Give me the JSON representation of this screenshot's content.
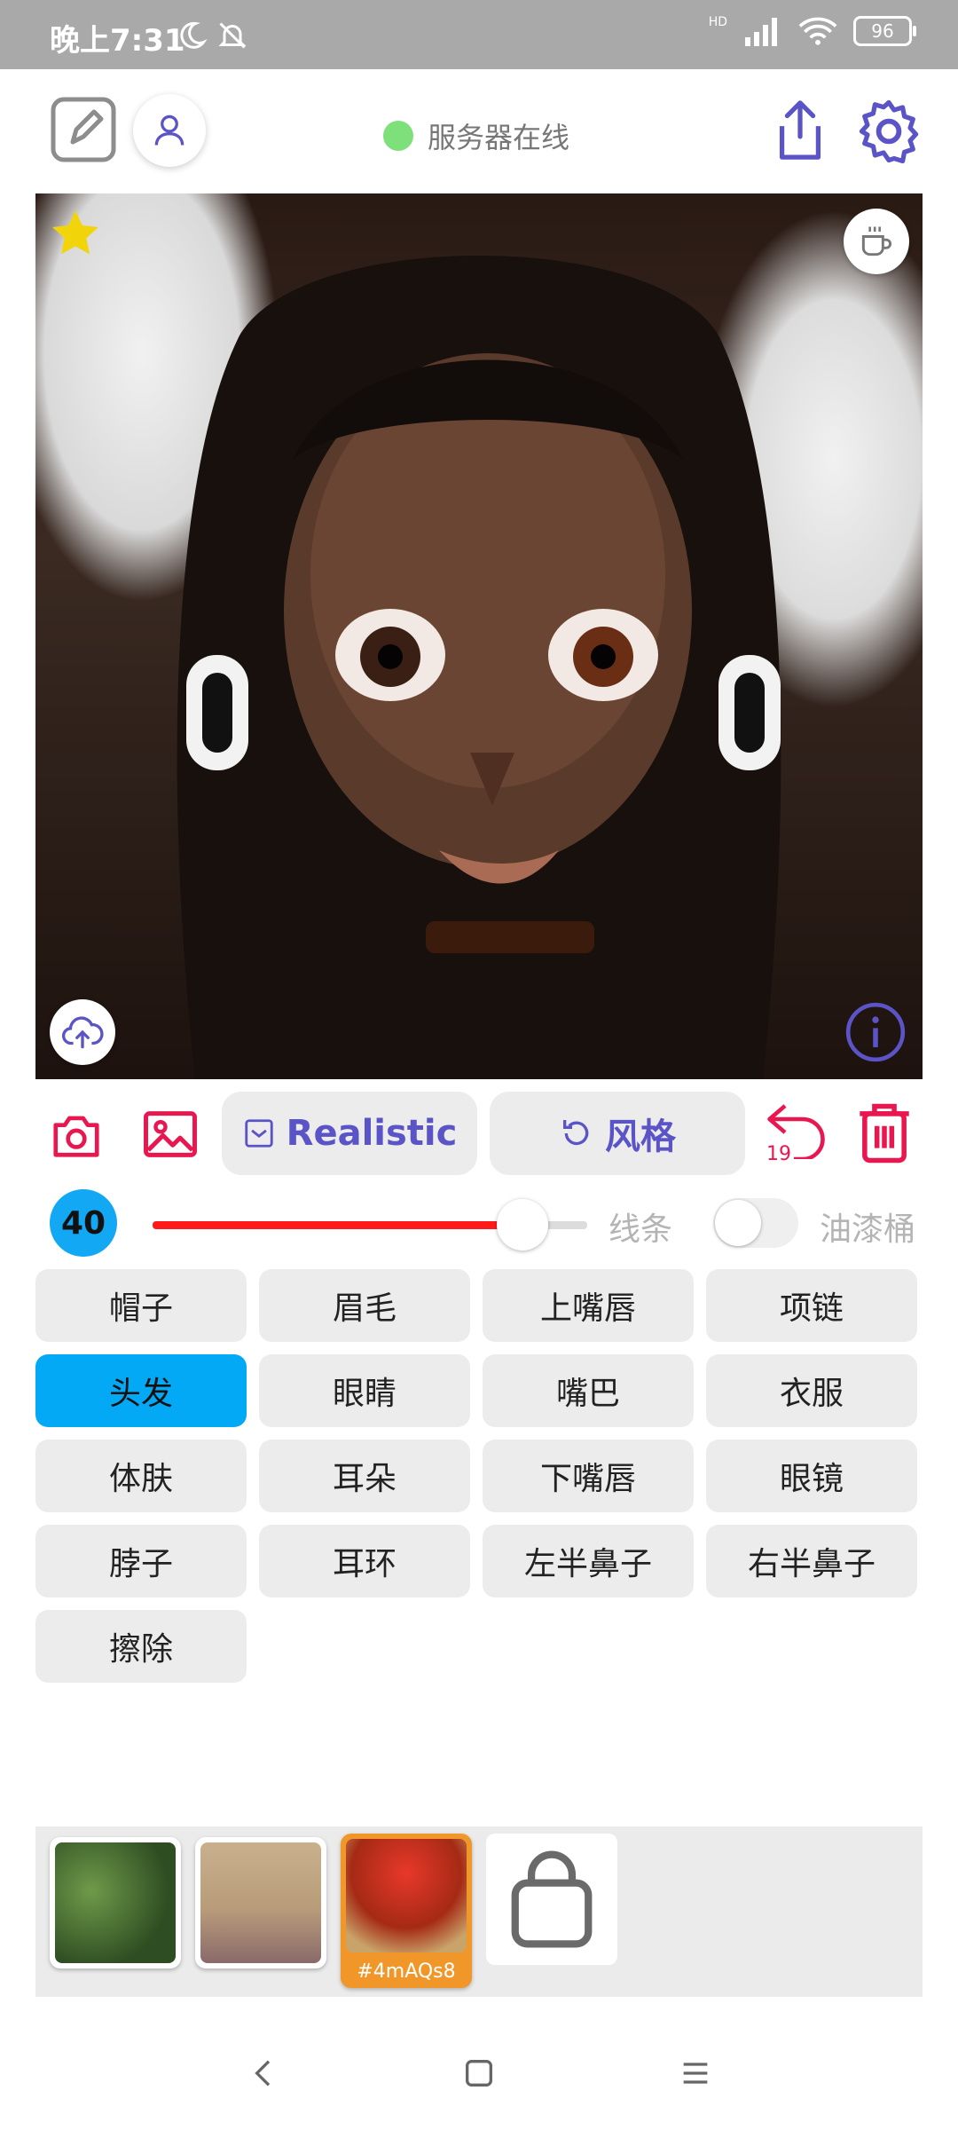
{
  "status_bar": {
    "time": "晚上7:31",
    "battery": "96",
    "network_badge": "HD"
  },
  "header": {
    "server_status": "服务器在线",
    "colors": {
      "accent": "#5a54c6",
      "online": "#7de07a"
    }
  },
  "image_overlays": {
    "favorite_color": "#f2d40a"
  },
  "tools": {
    "style_preset": "Realistic",
    "style_button": "风格",
    "undo_count": "19"
  },
  "brush": {
    "size": "40",
    "slider_fraction": 0.85,
    "line_label": "线条",
    "bucket_label": "油漆桶",
    "bucket_enabled": false
  },
  "segments": [
    "帽子",
    "眉毛",
    "上嘴唇",
    "项链",
    "头发",
    "眼睛",
    "嘴巴",
    "衣服",
    "体肤",
    "耳朵",
    "下嘴唇",
    "眼镜",
    "脖子",
    "耳环",
    "左半鼻子",
    "右半鼻子",
    "擦除"
  ],
  "selected_segment": "头发",
  "gallery": {
    "selected_tag": "#4mAQs8"
  }
}
